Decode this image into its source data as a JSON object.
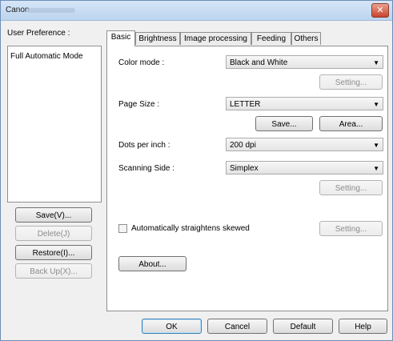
{
  "window": {
    "title": "Canon",
    "close_glyph": "✕"
  },
  "left": {
    "user_preference_label": "User Preference :",
    "list_items": [
      "Full Automatic Mode"
    ],
    "buttons": {
      "save": "Save(V)...",
      "delete": "Delete(J)",
      "restore": "Restore(I)...",
      "backup": "Back Up(X)..."
    }
  },
  "tabs": [
    "Basic",
    "Brightness",
    "Image processing",
    "Feeding",
    "Others"
  ],
  "basic": {
    "color_mode_label": "Color mode :",
    "color_mode_value": "Black and White",
    "color_setting": "Setting...",
    "page_size_label": "Page Size :",
    "page_size_value": "LETTER",
    "save_btn": "Save...",
    "area_btn": "Area...",
    "dpi_label": "Dots per inch :",
    "dpi_value": "200 dpi",
    "scan_side_label": "Scanning Side :",
    "scan_side_value": "Simplex",
    "scan_setting": "Setting...",
    "straighten_label": "Automatically straightens skewed",
    "straighten_setting": "Setting...",
    "about_btn": "About..."
  },
  "footer": {
    "ok": "OK",
    "cancel": "Cancel",
    "default": "Default",
    "help": "Help"
  },
  "colors": {
    "titlebar": "#c8dcf2",
    "close": "#c8432c",
    "panel_bg": "#ffffff",
    "window_bg": "#f0f0f0"
  }
}
